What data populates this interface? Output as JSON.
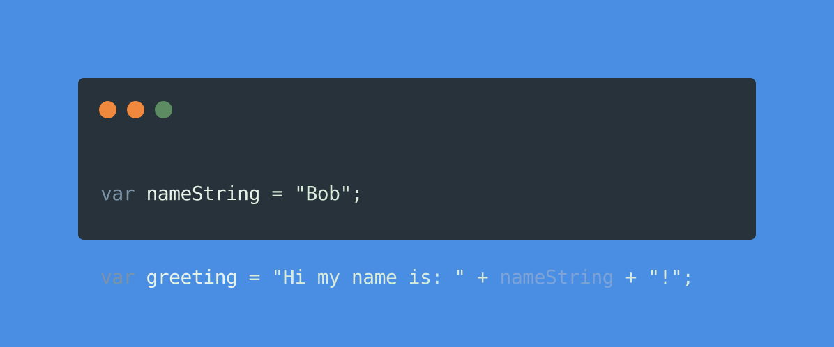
{
  "colors": {
    "background": "#4a8ee3",
    "window": "#27323a",
    "keyword": "#7d93a8",
    "identifier": "#e6f2e8",
    "string": "#d7eadb",
    "reference": "#7ea3d6"
  },
  "window_controls": [
    {
      "name": "close",
      "color": "#f0893e"
    },
    {
      "name": "minimize",
      "color": "#f0893e"
    },
    {
      "name": "maximize",
      "color": "#5e8c62"
    }
  ],
  "code": {
    "language": "javascript",
    "lines": [
      [
        {
          "type": "keyword",
          "text": "var"
        },
        {
          "type": "space",
          "text": " "
        },
        {
          "type": "ident",
          "text": "nameString"
        },
        {
          "type": "op",
          "text": " = "
        },
        {
          "type": "string",
          "text": "\"Bob\""
        },
        {
          "type": "punct",
          "text": ";"
        }
      ],
      [
        {
          "type": "keyword",
          "text": "var"
        },
        {
          "type": "space",
          "text": " "
        },
        {
          "type": "ident",
          "text": "greeting"
        },
        {
          "type": "op",
          "text": " = "
        },
        {
          "type": "string",
          "text": "\"Hi my name is: \""
        },
        {
          "type": "op",
          "text": " + "
        },
        {
          "type": "ref",
          "text": "nameString"
        },
        {
          "type": "op",
          "text": " + "
        },
        {
          "type": "string",
          "text": "\"!\""
        },
        {
          "type": "punct",
          "text": ";"
        }
      ]
    ]
  }
}
